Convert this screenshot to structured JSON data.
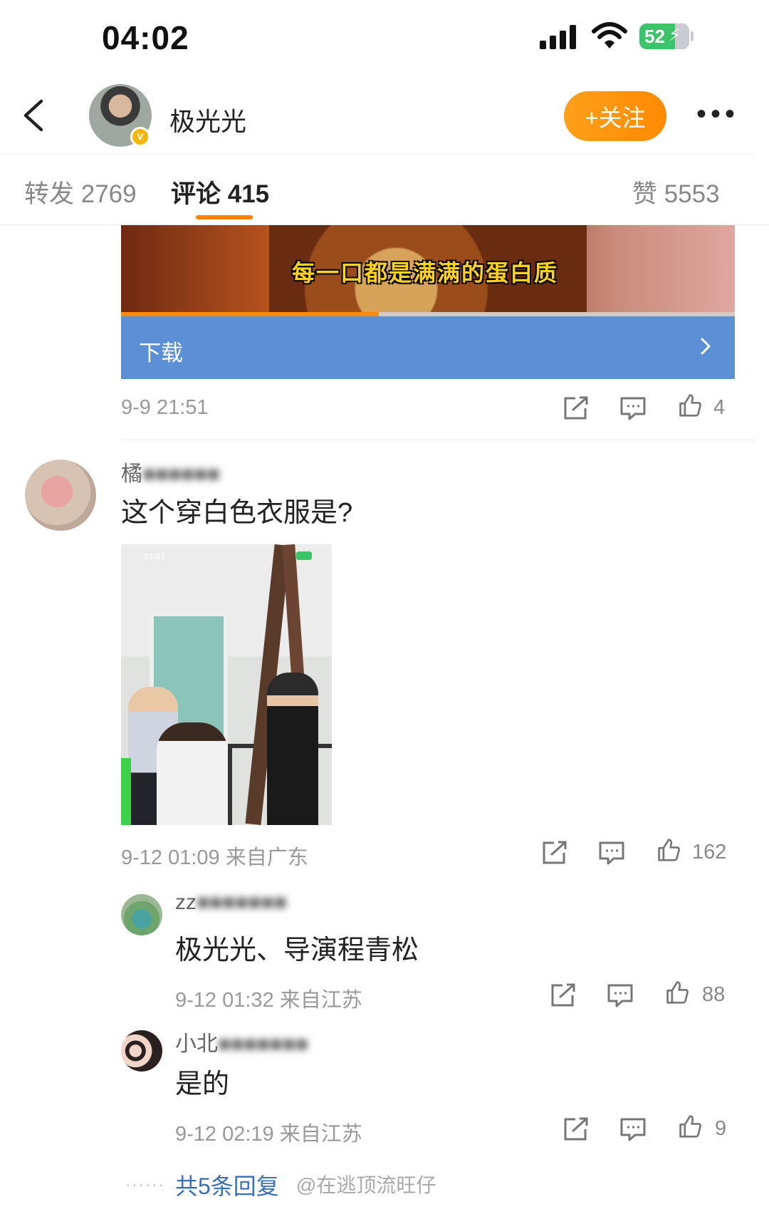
{
  "status_bar": {
    "time": "04:02",
    "battery": "52"
  },
  "header": {
    "username": "极光光",
    "follow_label": "+关注",
    "more_label": "•••"
  },
  "tabs": [
    {
      "label": "转发 2769",
      "active": false
    },
    {
      "label": "评论 415",
      "active": true
    },
    {
      "label": "赞 5553",
      "active": false
    }
  ],
  "video_card": {
    "caption": "每一口都是满满的蛋白质",
    "progress_fraction": 0.42,
    "download_label": "下载"
  },
  "post_meta": {
    "time": "9-9 21:51",
    "likes": "4"
  },
  "comment": {
    "author_visible": "橘",
    "text": "这个穿白色衣服是?",
    "photo_time": "01:03",
    "time": "9-12 01:09 来自广东",
    "likes": "162"
  },
  "replies": [
    {
      "author_visible": "zz",
      "text": "极光光、导演程青松",
      "time": "9-12 01:32 来自江苏",
      "likes": "88"
    },
    {
      "author_visible": "小北",
      "text": "是的",
      "time": "9-12 02:19 来自江苏",
      "likes": "9"
    }
  ],
  "more_replies_label": "共5条回复",
  "watermark": "@在逃顶流旺仔"
}
